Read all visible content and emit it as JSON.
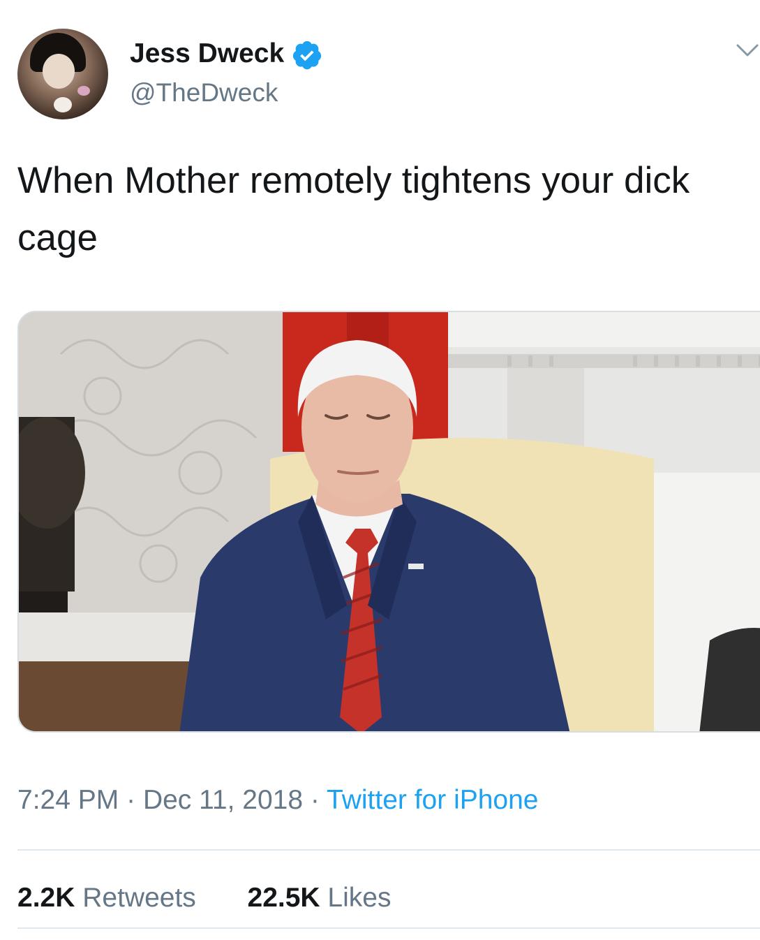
{
  "tweet": {
    "author": {
      "name": "Jess Dweck",
      "handle": "@TheDweck",
      "verified": true
    },
    "text": "When Mother remotely tightens your dick cage",
    "meta": {
      "time": "7:24 PM",
      "separator": "·",
      "date": "Dec 11, 2018",
      "source": "Twitter for iPhone"
    },
    "stats": {
      "retweets_count": "2.2K",
      "retweets_label": "Retweets",
      "likes_count": "22.5K",
      "likes_label": "Likes"
    }
  },
  "icons": {
    "verified": "verified-badge-icon",
    "more": "chevron-down-icon"
  },
  "colors": {
    "text": "#14171a",
    "secondary": "#657786",
    "link": "#1da1f2",
    "verified": "#1da1f2",
    "divider": "#e1e8ed"
  }
}
